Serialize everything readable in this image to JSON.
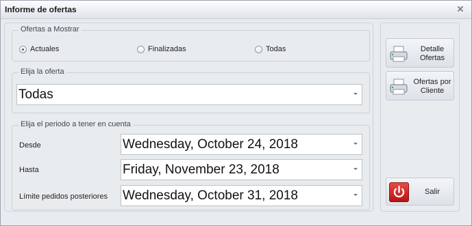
{
  "window": {
    "title": "Informe de ofertas"
  },
  "groups": {
    "ofertas_mostrar": {
      "legend": "Ofertas a Mostrar",
      "options": [
        "Actuales",
        "Finalizadas",
        "Todas"
      ],
      "selected": "Actuales"
    },
    "oferta": {
      "legend": "Elija la oferta",
      "value": "Todas"
    },
    "periodo": {
      "legend": "Elija el periodo a tener en cuenta",
      "desde_label": "Desde",
      "desde_value": "Wednesday, October 24, 2018",
      "hasta_label": "Hasta",
      "hasta_value": "Friday, November 23, 2018",
      "limite_label": "Límite pedidos posteriores",
      "limite_value": "Wednesday, October 31, 2018"
    }
  },
  "buttons": {
    "detalle": {
      "line1": "Detalle",
      "line2": "Ofertas",
      "icon": "printer-icon"
    },
    "por_cliente": {
      "line1": "Ofertas por",
      "line2": "Cliente",
      "icon": "printer-icon"
    },
    "salir": {
      "label": "Salir",
      "icon": "power-icon"
    }
  },
  "colors": {
    "power_red": "#d72b24"
  }
}
